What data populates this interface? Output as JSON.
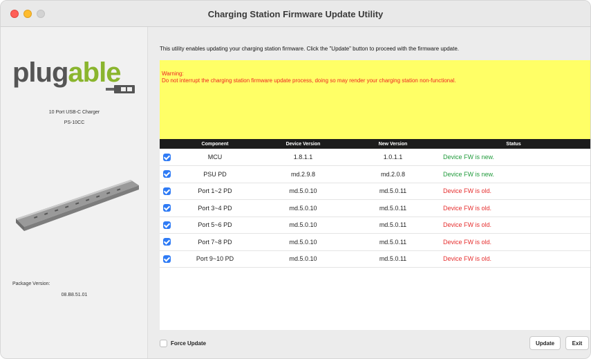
{
  "window": {
    "title": "Charging Station Firmware Update Utility"
  },
  "sidebar": {
    "logo_main": "plug",
    "logo_accent": "able",
    "model_name": "10 Port USB-C Charger",
    "model_id": "PS-10CC",
    "package_label": "Package Version:",
    "package_value": "08.B8.51.01"
  },
  "main": {
    "intro": "This utility enables updating your charging station firmware. Click the \"Update\" button to proceed with the firmware update.",
    "warning_title": "Warning:",
    "warning_message": "Do not interrupt the charging station firmware update process, doing so may render your charging station non-functional.",
    "table": {
      "headers": [
        "Component",
        "Device Version",
        "New Version",
        "Status"
      ],
      "rows": [
        {
          "component": "MCU",
          "device": "1.8.1.1",
          "new": "1.0.1.1",
          "status": "Device FW is new.",
          "state": "new"
        },
        {
          "component": "PSU PD",
          "device": "md.2.9.8",
          "new": "md.2.0.8",
          "status": "Device FW is new.",
          "state": "new"
        },
        {
          "component": "Port 1~2 PD",
          "device": "md.5.0.10",
          "new": "md.5.0.11",
          "status": "Device FW is old.",
          "state": "old"
        },
        {
          "component": "Port 3~4 PD",
          "device": "md.5.0.10",
          "new": "md.5.0.11",
          "status": "Device FW is old.",
          "state": "old"
        },
        {
          "component": "Port 5~6 PD",
          "device": "md.5.0.10",
          "new": "md.5.0.11",
          "status": "Device FW is old.",
          "state": "old"
        },
        {
          "component": "Port 7~8 PD",
          "device": "md.5.0.10",
          "new": "md.5.0.11",
          "status": "Device FW is old.",
          "state": "old"
        },
        {
          "component": "Port 9~10 PD",
          "device": "md.5.0.10",
          "new": "md.5.0.11",
          "status": "Device FW is old.",
          "state": "old"
        }
      ]
    },
    "force_update_label": "Force Update",
    "update_label": "Update",
    "exit_label": "Exit"
  },
  "colors": {
    "warning_bg": "#ffff66",
    "warning_text": "#e22222",
    "status_new": "#1f9a3a",
    "status_old": "#e62e2e",
    "checkbox": "#2f7bf5",
    "logo_accent": "#8ab52e"
  }
}
